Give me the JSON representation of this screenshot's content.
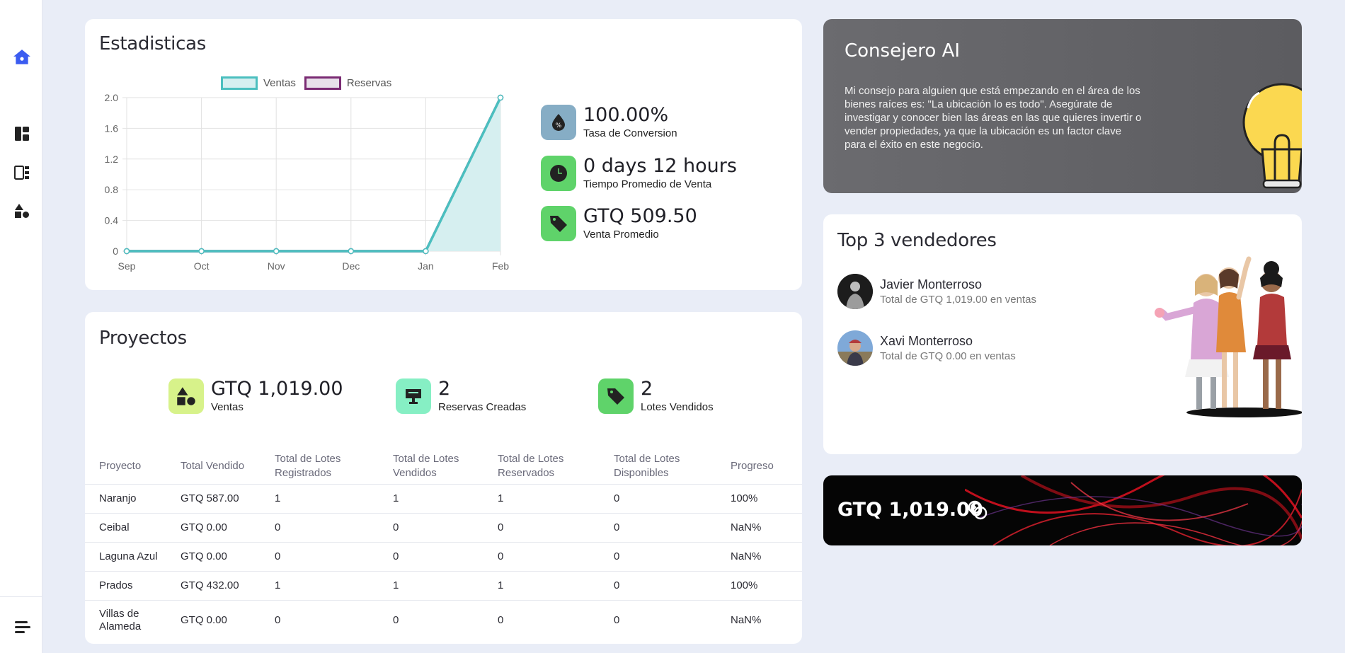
{
  "sidebar": {
    "icons": [
      "home-icon",
      "dashboard-icon",
      "layout-icon",
      "shapes-icon",
      "menu-icon"
    ]
  },
  "stats": {
    "title": "Estadisticas",
    "kpis": [
      {
        "value": "100.00%",
        "label": "Tasa de Conversion",
        "icon": "percent-drop-icon",
        "color": "#86adc5"
      },
      {
        "value": "0 days 12 hours",
        "label": "Tiempo Promedio de Venta",
        "icon": "clock-icon",
        "color": "#5fd36a"
      },
      {
        "value": "GTQ 509.50",
        "label": "Venta Promedio",
        "icon": "tag-icon",
        "color": "#5fd36a"
      }
    ]
  },
  "chart_data": {
    "type": "line",
    "categories": [
      "Sep",
      "Oct",
      "Nov",
      "Dec",
      "Jan",
      "Feb"
    ],
    "series": [
      {
        "name": "Ventas",
        "values": [
          0,
          0,
          0,
          0,
          0,
          2
        ],
        "color": "#4bbfbf",
        "fill": "#d6eff0"
      },
      {
        "name": "Reservas",
        "values": [
          0,
          0,
          0,
          0,
          0,
          2
        ],
        "color": "#7a2a73",
        "fill": "#e8e1ea"
      }
    ],
    "ylim": [
      0,
      2.0
    ],
    "yticks": [
      "0",
      "0.4",
      "0.8",
      "1.2",
      "1.6",
      "2.0"
    ],
    "grid": true,
    "legend": "top"
  },
  "projects": {
    "title": "Proyectos",
    "stats": [
      {
        "value": "GTQ 1,019.00",
        "label": "Ventas",
        "icon": "shapes-icon",
        "color": "#d7f28a"
      },
      {
        "value": "2",
        "label": "Reservas Creadas",
        "icon": "presentation-icon",
        "color": "#86efc4"
      },
      {
        "value": "2",
        "label": "Lotes Vendidos",
        "icon": "tag-icon",
        "color": "#5fd36a"
      }
    ],
    "columns": [
      "Proyecto",
      "Total Vendido",
      "Total de Lotes Registrados",
      "Total de Lotes Vendidos",
      "Total de Lotes Reservados",
      "Total de Lotes Disponibles",
      "Progreso"
    ],
    "rows": [
      [
        "Naranjo",
        "GTQ 587.00",
        "1",
        "1",
        "1",
        "0",
        "100%"
      ],
      [
        "Ceibal",
        "GTQ 0.00",
        "0",
        "0",
        "0",
        "0",
        "NaN%"
      ],
      [
        "Laguna Azul",
        "GTQ 0.00",
        "0",
        "0",
        "0",
        "0",
        "NaN%"
      ],
      [
        "Prados",
        "GTQ 432.00",
        "1",
        "1",
        "1",
        "0",
        "100%"
      ],
      [
        "Villas de Alameda",
        "GTQ 0.00",
        "0",
        "0",
        "0",
        "0",
        "NaN%"
      ]
    ]
  },
  "ai": {
    "title": "Consejero AI",
    "text": "Mi consejo para alguien que está empezando en el área de los bienes raíces es: \"La ubicación lo es todo\". Asegúrate de investigar y conocer bien las áreas en las que quieres invertir o vender propiedades, ya que la ubicación es un factor clave para el éxito en este negocio."
  },
  "top": {
    "title": "Top 3 vendedores",
    "sellers": [
      {
        "name": "Javier Monterroso",
        "sub": "Total de GTQ 1,019.00 en ventas"
      },
      {
        "name": "Xavi Monterroso",
        "sub": "Total de GTQ 0.00 en ventas"
      }
    ]
  },
  "banner": {
    "amount": "GTQ 1,019.00",
    "icon": "coins-icon"
  }
}
